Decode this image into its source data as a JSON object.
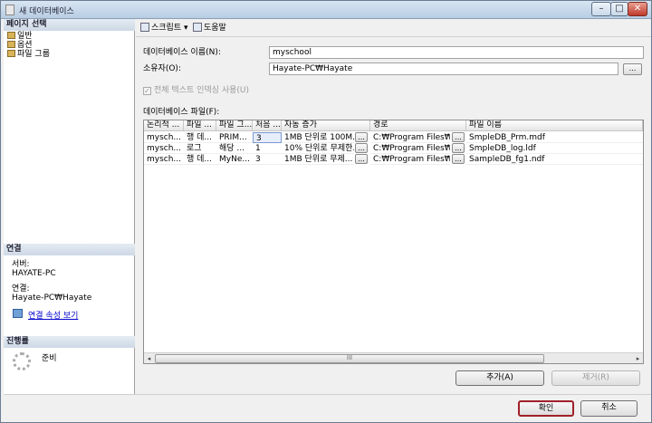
{
  "window": {
    "title": "새 데이터베이스",
    "min": "–",
    "max": "□",
    "close": "✕"
  },
  "sidebar": {
    "pages_header": "페이지 선택",
    "pages": [
      {
        "label": "일반",
        "icon": "page-icon"
      },
      {
        "label": "옵션",
        "icon": "page-icon"
      },
      {
        "label": "파일 그룹",
        "icon": "page-icon"
      }
    ],
    "connection_header": "연결",
    "server_label": "서버:",
    "server_value": "HAYATE-PC",
    "conn_label": "연결:",
    "conn_value": "Hayate-PC₩Hayate",
    "conn_link": "연결 속성 보기",
    "progress_header": "진행률",
    "progress_status": "준비"
  },
  "toolbar": {
    "script_label": "스크립트",
    "script_arrow": "▾",
    "help_label": "도움말"
  },
  "form": {
    "db_name_label": "데이터베이스 이름(N):",
    "db_name_value": "myschool",
    "owner_label": "소유자(O):",
    "owner_value": "Hayate-PC₩Hayate",
    "browse_label": "...",
    "fulltext_label": "전체 텍스트 인덱싱 사용(U)",
    "fulltext_checked": "✓",
    "files_label": "데이터베이스 파일(F):"
  },
  "grid": {
    "columns": [
      "논리적 ...",
      "파일 ...",
      "파일 그...",
      "처음 ...",
      "자동 증가",
      "경로",
      "파일 이름"
    ],
    "rows": [
      {
        "logical": "mysch...",
        "type": "행 데...",
        "group": "PRIM...",
        "initial": "3",
        "growth": "1MB 단위로 100M...",
        "path": "C:₩Program Files₩...",
        "filename": "SmpleDB_Prm.mdf"
      },
      {
        "logical": "mysch...",
        "type": "로그",
        "group": "해당 ...",
        "initial": "1",
        "growth": "10% 단위로 무제한...",
        "path": "C:₩Program Files₩...",
        "filename": "SmpleDB_log.ldf"
      },
      {
        "logical": "mysch...",
        "type": "행 데...",
        "group": "MyNe...",
        "initial": "3",
        "growth": "1MB 단위로 무제...",
        "path": "C:₩Program Files₩...",
        "filename": "SampleDB_fg1.ndf"
      }
    ],
    "scroll_left": "◂",
    "scroll_right": "▸",
    "scroll_grip": "III"
  },
  "buttons": {
    "add": "추가(A)",
    "remove": "제거(R)",
    "ok": "확인",
    "cancel": "취소"
  }
}
